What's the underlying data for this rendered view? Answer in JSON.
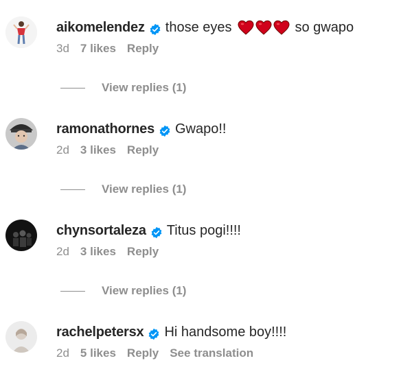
{
  "comments": [
    {
      "username": "aikomelendez",
      "text": "those eyes",
      "text_after": "so gwapo",
      "emoji": "red-heart x3",
      "age": "3d",
      "likes": "7 likes",
      "reply": "Reply",
      "view_replies": "View replies (1)"
    },
    {
      "username": "ramonathornes",
      "text": "Gwapo!!",
      "age": "2d",
      "likes": "3 likes",
      "reply": "Reply",
      "view_replies": "View replies (1)"
    },
    {
      "username": "chynsortaleza",
      "text": "Titus pogi!!!!",
      "age": "2d",
      "likes": "3 likes",
      "reply": "Reply",
      "view_replies": "View replies (1)"
    },
    {
      "username": "rachelpetersx",
      "text": "Hi handsome boy!!!!",
      "age": "2d",
      "likes": "5 likes",
      "reply": "Reply",
      "see_translation": "See translation"
    }
  ],
  "colors": {
    "text": "#262626",
    "secondary": "#8e8e8e",
    "verified": "#0095f6",
    "heart": "#d0021b"
  }
}
